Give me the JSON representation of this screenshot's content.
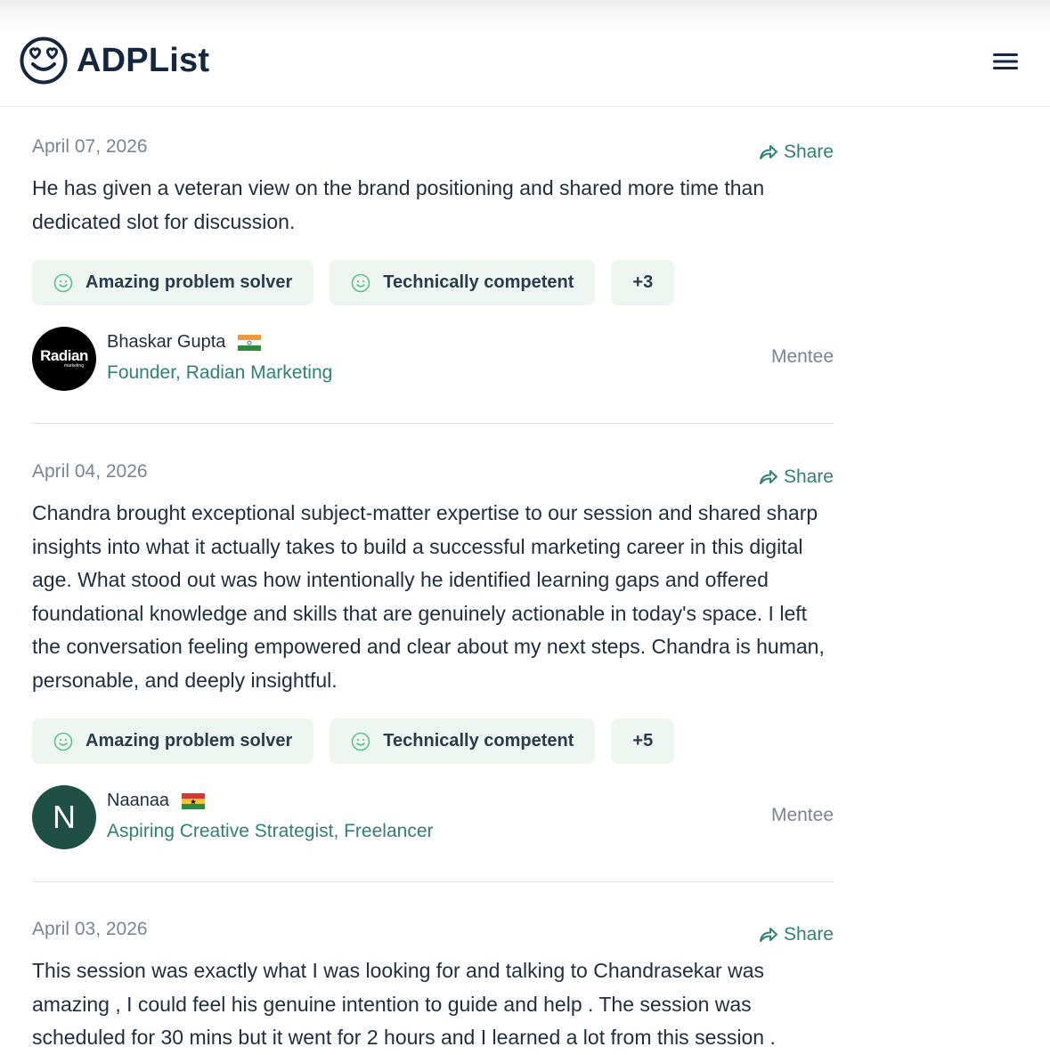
{
  "app": {
    "name": "ADPList"
  },
  "reviews": [
    {
      "date": "April 07, 2026",
      "share_label": "Share",
      "text": "He has given a veteran view on the brand positioning and shared more time than dedicated slot for discussion.",
      "tags": [
        "Amazing problem solver",
        "Technically competent"
      ],
      "more_tags": "+3",
      "reviewer": {
        "name": "Bhaskar Gupta",
        "flag": "india-flag",
        "role": "Founder, Radian Marketing",
        "type": "Mentee",
        "avatar_text": "Radian",
        "avatar_subtext": "marketing"
      }
    },
    {
      "date": "April 04, 2026",
      "share_label": "Share",
      "text": "Chandra brought exceptional subject-matter expertise to our session and shared sharp insights into what it actually takes to build a successful marketing career in this digital age. What stood out was how intentionally he identified learning gaps and offered foundational knowledge and skills that are genuinely actionable in today's space. I left the conversation feeling empowered and clear about my next steps. Chandra is human, personable, and deeply insightful.",
      "tags": [
        "Amazing problem solver",
        "Technically competent"
      ],
      "more_tags": "+5",
      "reviewer": {
        "name": "Naanaa",
        "flag": "ghana-flag",
        "role": "Aspiring Creative Strategist, Freelancer",
        "type": "Mentee",
        "avatar_text": "N"
      }
    },
    {
      "date": "April 03, 2026",
      "share_label": "Share",
      "text": "This session was exactly what I was looking for and talking to Chandrasekar was amazing , I could feel his genuine intention to guide and help . The session was scheduled for 30 mins but it went for 2 hours and I learned a lot from this session ."
    }
  ],
  "colors": {
    "accent": "#2f8075",
    "brand": "#15263f",
    "tag_bg": "#eef6f2"
  }
}
